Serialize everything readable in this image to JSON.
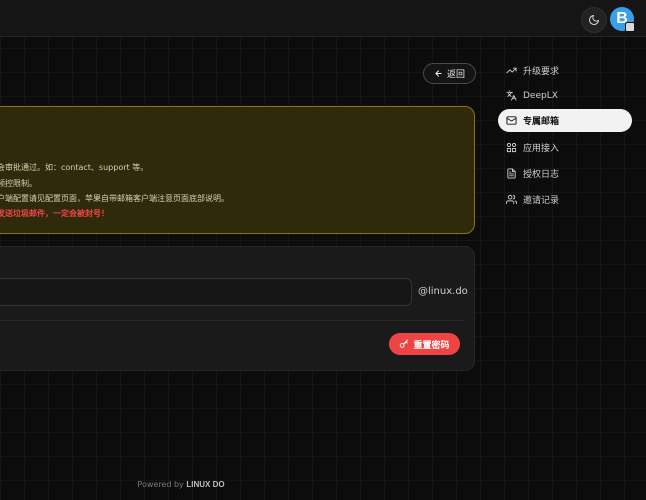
{
  "header": {
    "theme_toggle_icon": "moon-icon",
    "avatar_letter": "B",
    "avatar_color": "#3b9ee8"
  },
  "back_button": {
    "label": "返回",
    "icon": "arrow-left-icon"
  },
  "notice": {
    "lines": [
      "不会审批通过。如：contact、support 等。",
      "信频控限制。",
      "客户端配置请见配置页面，苹果自带邮箱客户端注意页面底部说明。",
      "意发送垃圾邮件，一定会被封号！"
    ],
    "warning_color": "#f04545",
    "border_color": "#8a7416",
    "background_color": "#2e2a0b"
  },
  "email_form": {
    "input_value": "",
    "domain_suffix": "@linux.do",
    "reset_button_label": "重置密码",
    "reset_button_icon": "key-icon",
    "reset_button_color": "#ef4444"
  },
  "sidebar": {
    "items": [
      {
        "label": "升级要求",
        "icon": "trending-up-icon",
        "active": false
      },
      {
        "label": "DeepLX",
        "icon": "translate-icon",
        "active": false
      },
      {
        "label": "专属邮箱",
        "icon": "mail-icon",
        "active": true
      },
      {
        "label": "应用接入",
        "icon": "apps-icon",
        "active": false
      },
      {
        "label": "授权日志",
        "icon": "file-text-icon",
        "active": false
      },
      {
        "label": "邀请记录",
        "icon": "users-icon",
        "active": false
      }
    ]
  },
  "footer": {
    "prefix": "Powered by ",
    "brand": "LINUX DO"
  }
}
